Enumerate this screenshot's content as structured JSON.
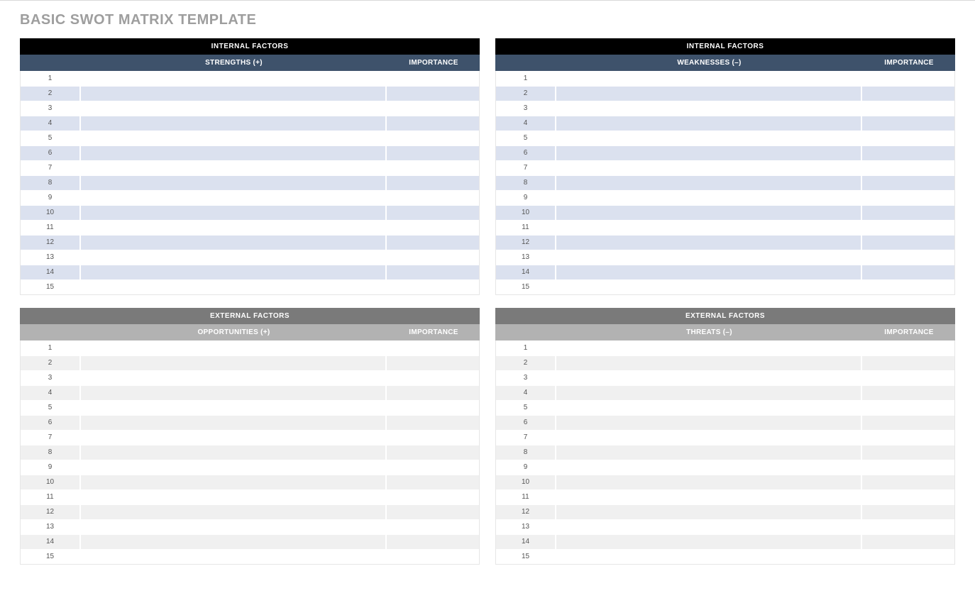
{
  "title": "BASIC SWOT MATRIX TEMPLATE",
  "row_count": 15,
  "panels": {
    "strengths": {
      "factor_label": "INTERNAL FACTORS",
      "main_label": "STRENGTHS (+)",
      "importance_label": "IMPORTANCE",
      "rows": [
        {
          "n": "1",
          "text": "",
          "importance": ""
        },
        {
          "n": "2",
          "text": "",
          "importance": ""
        },
        {
          "n": "3",
          "text": "",
          "importance": ""
        },
        {
          "n": "4",
          "text": "",
          "importance": ""
        },
        {
          "n": "5",
          "text": "",
          "importance": ""
        },
        {
          "n": "6",
          "text": "",
          "importance": ""
        },
        {
          "n": "7",
          "text": "",
          "importance": ""
        },
        {
          "n": "8",
          "text": "",
          "importance": ""
        },
        {
          "n": "9",
          "text": "",
          "importance": ""
        },
        {
          "n": "10",
          "text": "",
          "importance": ""
        },
        {
          "n": "11",
          "text": "",
          "importance": ""
        },
        {
          "n": "12",
          "text": "",
          "importance": ""
        },
        {
          "n": "13",
          "text": "",
          "importance": ""
        },
        {
          "n": "14",
          "text": "",
          "importance": ""
        },
        {
          "n": "15",
          "text": "",
          "importance": ""
        }
      ]
    },
    "weaknesses": {
      "factor_label": "INTERNAL FACTORS",
      "main_label": "WEAKNESSES (–)",
      "importance_label": "IMPORTANCE",
      "rows": [
        {
          "n": "1",
          "text": "",
          "importance": ""
        },
        {
          "n": "2",
          "text": "",
          "importance": ""
        },
        {
          "n": "3",
          "text": "",
          "importance": ""
        },
        {
          "n": "4",
          "text": "",
          "importance": ""
        },
        {
          "n": "5",
          "text": "",
          "importance": ""
        },
        {
          "n": "6",
          "text": "",
          "importance": ""
        },
        {
          "n": "7",
          "text": "",
          "importance": ""
        },
        {
          "n": "8",
          "text": "",
          "importance": ""
        },
        {
          "n": "9",
          "text": "",
          "importance": ""
        },
        {
          "n": "10",
          "text": "",
          "importance": ""
        },
        {
          "n": "11",
          "text": "",
          "importance": ""
        },
        {
          "n": "12",
          "text": "",
          "importance": ""
        },
        {
          "n": "13",
          "text": "",
          "importance": ""
        },
        {
          "n": "14",
          "text": "",
          "importance": ""
        },
        {
          "n": "15",
          "text": "",
          "importance": ""
        }
      ]
    },
    "opportunities": {
      "factor_label": "EXTERNAL FACTORS",
      "main_label": "OPPORTUNITIES (+)",
      "importance_label": "IMPORTANCE",
      "rows": [
        {
          "n": "1",
          "text": "",
          "importance": ""
        },
        {
          "n": "2",
          "text": "",
          "importance": ""
        },
        {
          "n": "3",
          "text": "",
          "importance": ""
        },
        {
          "n": "4",
          "text": "",
          "importance": ""
        },
        {
          "n": "5",
          "text": "",
          "importance": ""
        },
        {
          "n": "6",
          "text": "",
          "importance": ""
        },
        {
          "n": "7",
          "text": "",
          "importance": ""
        },
        {
          "n": "8",
          "text": "",
          "importance": ""
        },
        {
          "n": "9",
          "text": "",
          "importance": ""
        },
        {
          "n": "10",
          "text": "",
          "importance": ""
        },
        {
          "n": "11",
          "text": "",
          "importance": ""
        },
        {
          "n": "12",
          "text": "",
          "importance": ""
        },
        {
          "n": "13",
          "text": "",
          "importance": ""
        },
        {
          "n": "14",
          "text": "",
          "importance": ""
        },
        {
          "n": "15",
          "text": "",
          "importance": ""
        }
      ]
    },
    "threats": {
      "factor_label": "EXTERNAL FACTORS",
      "main_label": "THREATS (–)",
      "importance_label": "IMPORTANCE",
      "rows": [
        {
          "n": "1",
          "text": "",
          "importance": ""
        },
        {
          "n": "2",
          "text": "",
          "importance": ""
        },
        {
          "n": "3",
          "text": "",
          "importance": ""
        },
        {
          "n": "4",
          "text": "",
          "importance": ""
        },
        {
          "n": "5",
          "text": "",
          "importance": ""
        },
        {
          "n": "6",
          "text": "",
          "importance": ""
        },
        {
          "n": "7",
          "text": "",
          "importance": ""
        },
        {
          "n": "8",
          "text": "",
          "importance": ""
        },
        {
          "n": "9",
          "text": "",
          "importance": ""
        },
        {
          "n": "10",
          "text": "",
          "importance": ""
        },
        {
          "n": "11",
          "text": "",
          "importance": ""
        },
        {
          "n": "12",
          "text": "",
          "importance": ""
        },
        {
          "n": "13",
          "text": "",
          "importance": ""
        },
        {
          "n": "14",
          "text": "",
          "importance": ""
        },
        {
          "n": "15",
          "text": "",
          "importance": ""
        }
      ]
    }
  }
}
